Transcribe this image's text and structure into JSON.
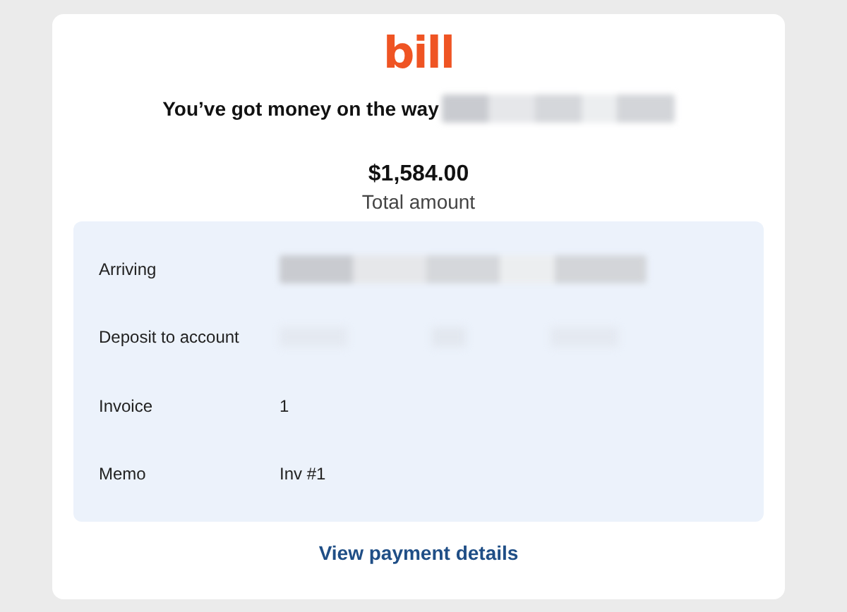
{
  "logo": "bill",
  "heading": {
    "text": "You’ve got money on the way",
    "redacted": true
  },
  "amount": {
    "value": "$1,584.00",
    "label": "Total amount"
  },
  "details": [
    {
      "label": "Arriving",
      "kind": "redacted"
    },
    {
      "label": "Deposit to account",
      "kind": "faint"
    },
    {
      "label": "Invoice",
      "kind": "text",
      "value": "1"
    },
    {
      "label": "Memo",
      "kind": "text",
      "value": "Inv #1"
    }
  ],
  "link": "View payment details"
}
